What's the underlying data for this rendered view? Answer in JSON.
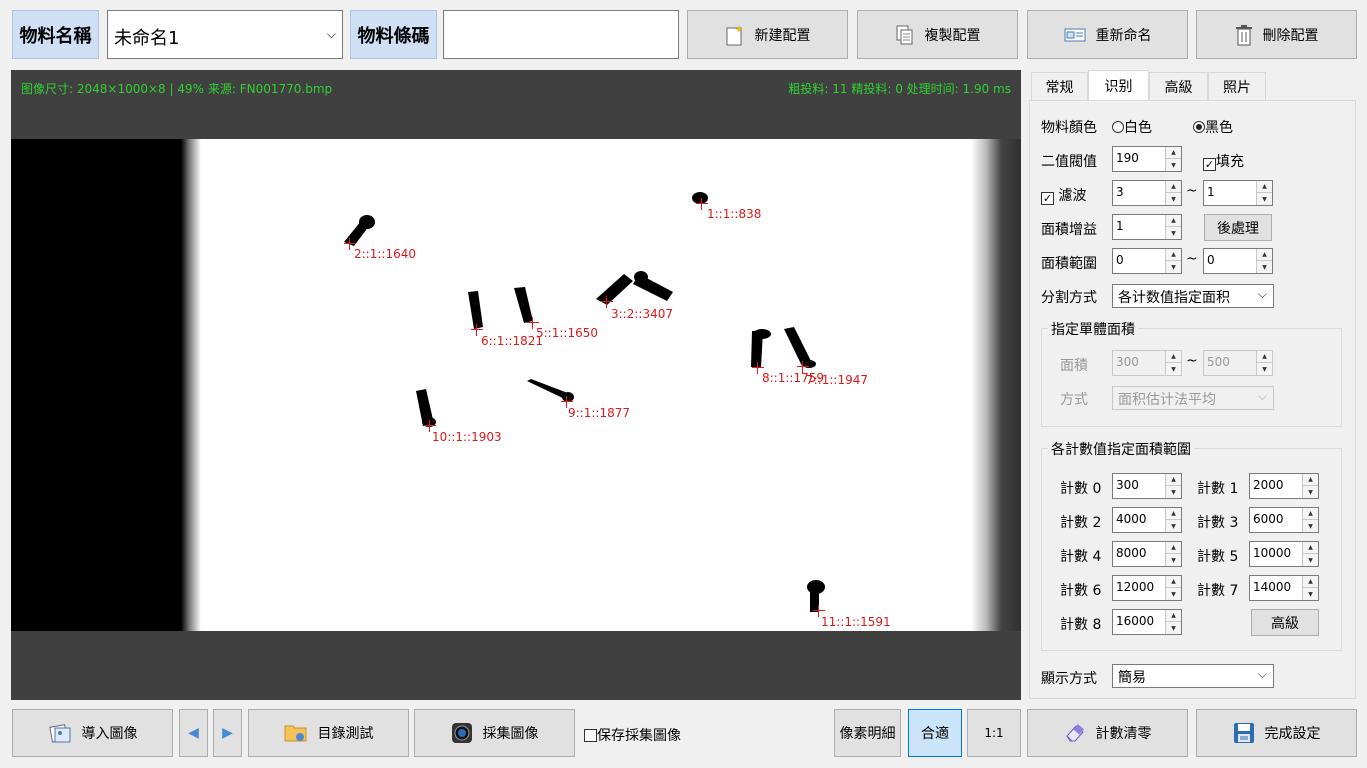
{
  "top": {
    "material_name_label": "物料名稱",
    "material_name_value": "未命名1",
    "material_barcode_label": "物料條碼",
    "material_barcode_value": "",
    "buttons": {
      "new": "新建配置",
      "copy": "複製配置",
      "rename": "重新命名",
      "delete": "刪除配置"
    }
  },
  "viewer": {
    "info_left": "图像尺寸: 2048×1000×8 | 49%   来源: FN001770.bmp",
    "info_right": "粗投料: 11   精投料: 0   处理时间: 1.90 ms",
    "marks": [
      "1::1::838",
      "2::1::1640",
      "3::2::3407",
      "5::1::1650",
      "6::1::1821",
      "8::1::1759",
      "7::1::1947",
      "9::1::1877",
      "10::1::1903",
      "11::1::1591"
    ]
  },
  "tabs": [
    "常规",
    "识别",
    "高級",
    "照片"
  ],
  "active_tab": "识别",
  "settings": {
    "color_label": "物料顏色",
    "color_white": "白色",
    "color_black": "黑色",
    "color_selected": "黑色",
    "threshold_label": "二值閥值",
    "threshold_value": "190",
    "fill_label": "填充",
    "fill_checked": true,
    "filter_label": "濾波",
    "filter_checked": true,
    "filter_from": "3",
    "filter_to": "1",
    "tilde": "~",
    "gain_label": "面積增益",
    "gain_value": "1",
    "post_button": "後處理",
    "range_label": "面積範圍",
    "range_from": "0",
    "range_to": "0",
    "split_label": "分割方式",
    "split_value": "各计数值指定面积",
    "unit_group_title": "指定單體面積",
    "unit_area_label": "面積",
    "unit_area_from": "300",
    "unit_area_to": "500",
    "unit_method_label": "方式",
    "unit_method_value": "面积估计法平均",
    "count_group_title": "各計數值指定面積範圍",
    "counts": [
      {
        "label": "計數 0",
        "value": "300"
      },
      {
        "label": "計數 1",
        "value": "2000"
      },
      {
        "label": "計數 2",
        "value": "4000"
      },
      {
        "label": "計數 3",
        "value": "6000"
      },
      {
        "label": "計數 4",
        "value": "8000"
      },
      {
        "label": "計數 5",
        "value": "10000"
      },
      {
        "label": "計數 6",
        "value": "12000"
      },
      {
        "label": "計數 7",
        "value": "14000"
      },
      {
        "label": "計數 8",
        "value": "16000"
      }
    ],
    "advanced_button": "高級",
    "display_label": "顯示方式",
    "display_value": "簡易"
  },
  "bottom": {
    "import": "導入圖像",
    "dir_test": "目錄測試",
    "capture": "採集圖像",
    "save_capture": "保存採集圖像",
    "pixel_detail": "像素明細",
    "fit": "合適",
    "one_to_one": "1:1",
    "clear_count": "計數清零",
    "finish": "完成設定"
  }
}
